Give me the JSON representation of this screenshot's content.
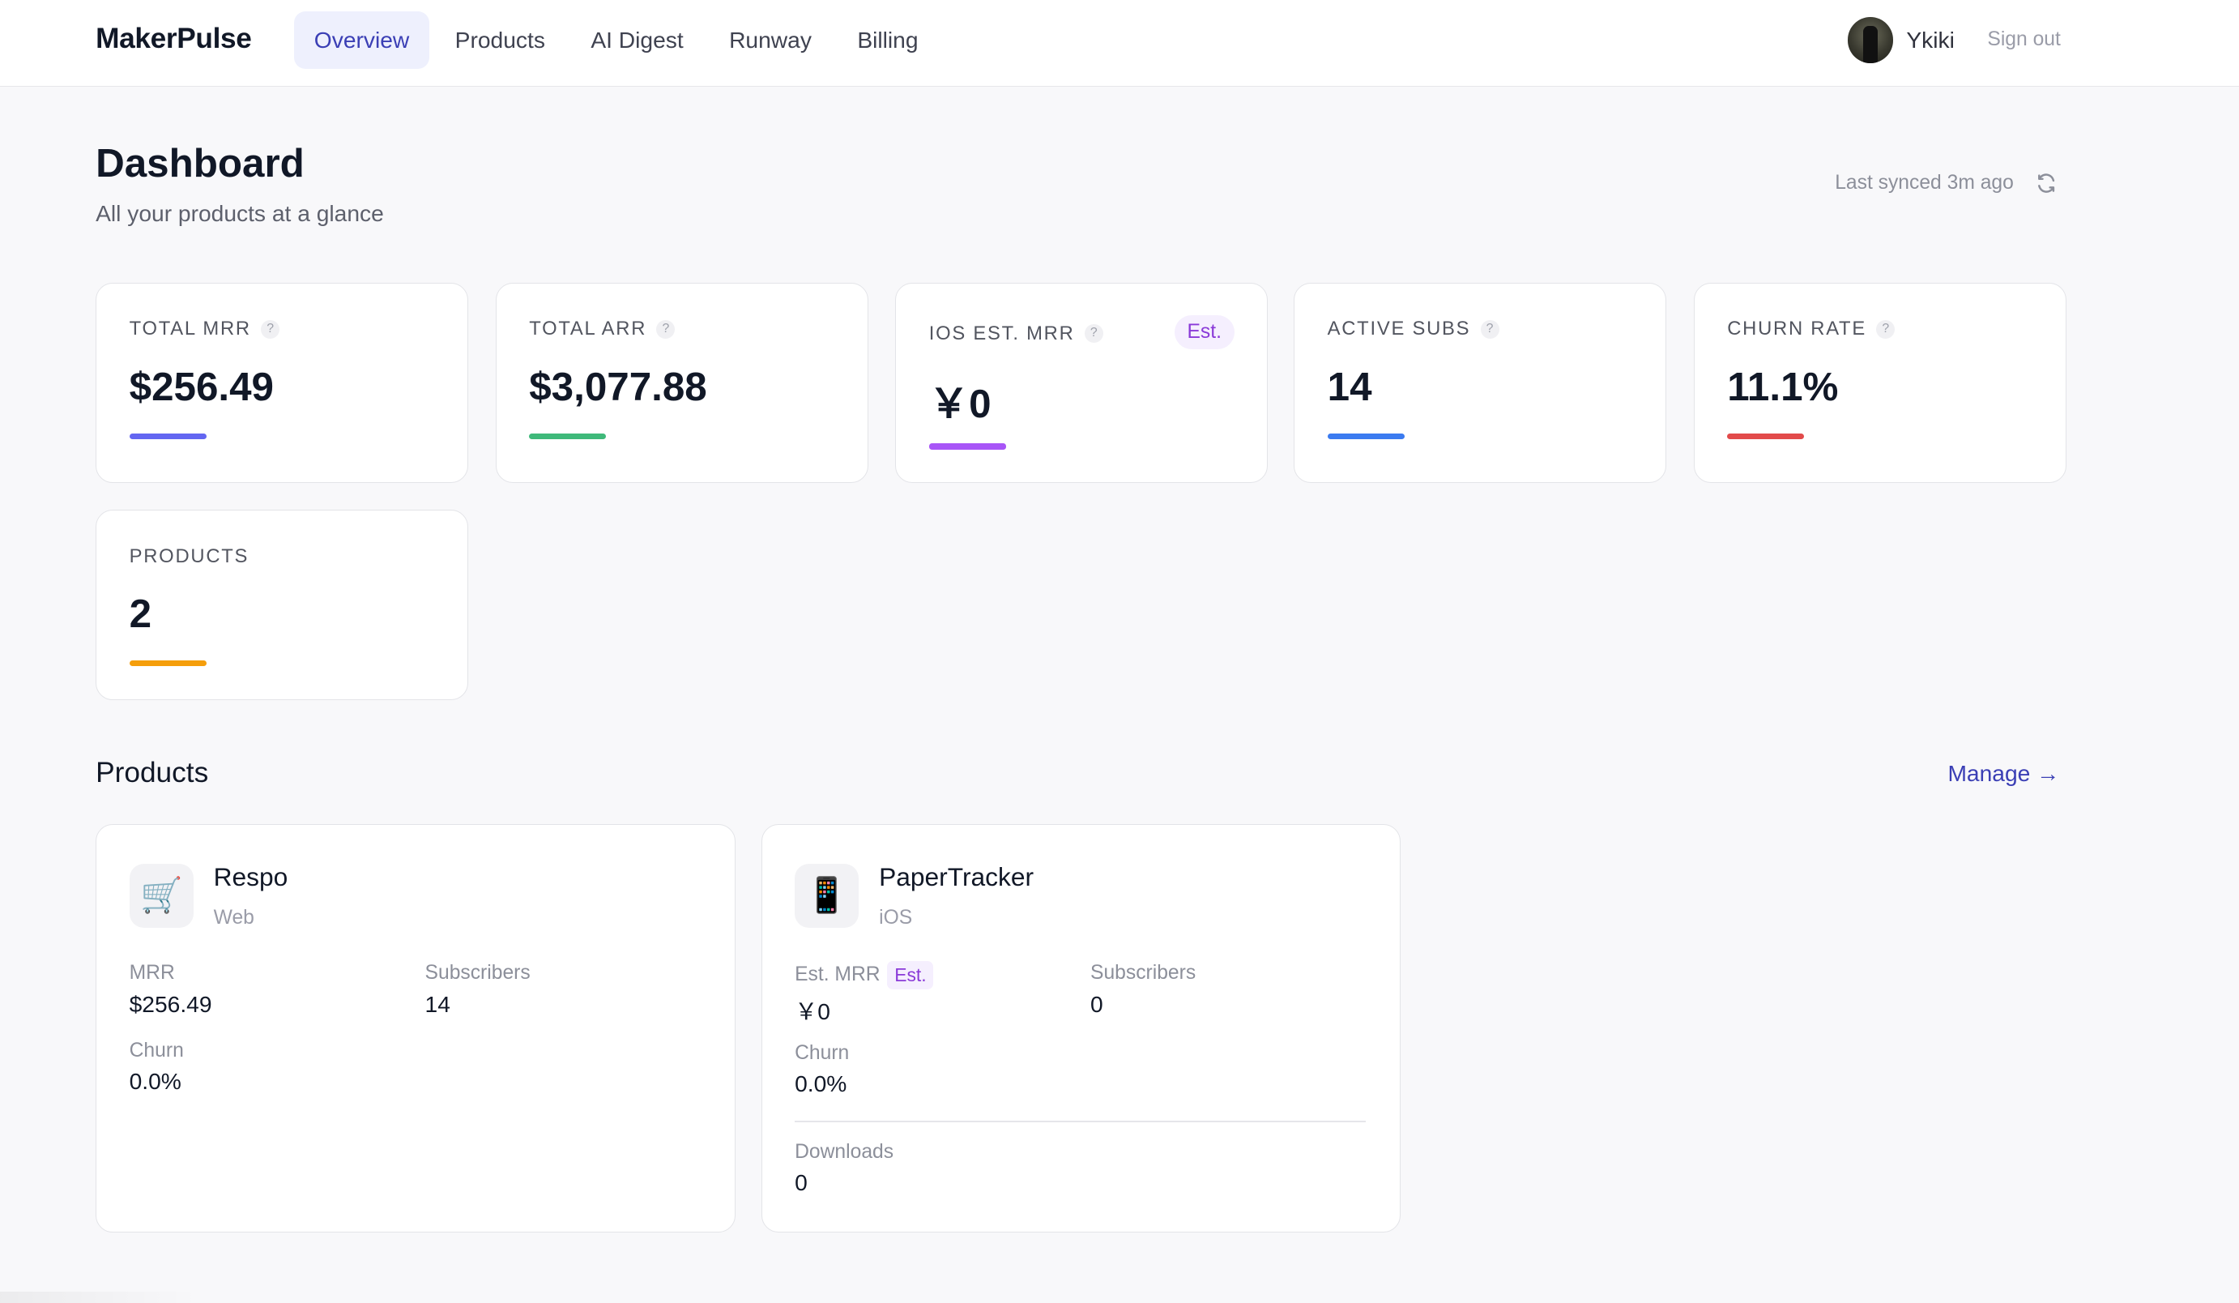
{
  "brand": "MakerPulse",
  "nav": [
    "Overview",
    "Products",
    "AI Digest",
    "Runway",
    "Billing"
  ],
  "user": {
    "name": "Ykiki",
    "signout": "Sign out"
  },
  "header": {
    "title": "Dashboard",
    "subtitle": "All your products at a glance",
    "sync": "Last synced 3m ago"
  },
  "metrics": [
    {
      "label": "TOTAL MRR",
      "value": "$256.49",
      "accent": "#6366f1"
    },
    {
      "label": "TOTAL ARR",
      "value": "$3,077.88",
      "accent": "#3fb97a"
    },
    {
      "label": "IOS EST. MRR",
      "value": "￥0",
      "badge": "Est.",
      "accent": "#a855f7"
    },
    {
      "label": "ACTIVE SUBS",
      "value": "14",
      "accent": "#3b7bf0"
    },
    {
      "label": "CHURN RATE",
      "value": "11.1%",
      "accent": "#e24a4a"
    },
    {
      "label": "PRODUCTS",
      "value": "2",
      "accent": "#f59e0b"
    }
  ],
  "help_glyph": "?",
  "products_section": {
    "title": "Products",
    "manage": "Manage →"
  },
  "products": [
    {
      "name": "Respo",
      "platform": "Web",
      "icon": "🛒",
      "mrr_label": "MRR",
      "mrr": "$256.49",
      "subs_label": "Subscribers",
      "subs": "14",
      "churn_label": "Churn",
      "churn": "0.0%"
    },
    {
      "name": "PaperTracker",
      "platform": "iOS",
      "icon": "📱",
      "mrr_label": "Est. MRR",
      "est_badge": "Est.",
      "mrr": "￥0",
      "subs_label": "Subscribers",
      "subs": "0",
      "churn_label": "Churn",
      "churn": "0.0%",
      "downloads_label": "Downloads",
      "downloads": "0"
    }
  ]
}
